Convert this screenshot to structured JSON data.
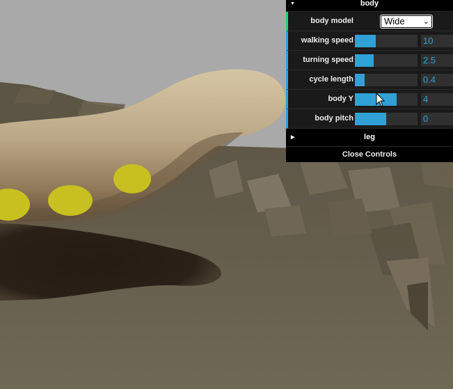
{
  "gui": {
    "body_folder": {
      "title": "body",
      "body_model": {
        "label": "body model",
        "value": "Wide"
      },
      "sliders": [
        {
          "label": "walking speed",
          "value": "10",
          "fill_fraction": 0.33
        },
        {
          "label": "turning speed",
          "value": "2.5",
          "fill_fraction": 0.3
        },
        {
          "label": "cycle length",
          "value": "0.4",
          "fill_fraction": 0.15
        },
        {
          "label": "body Y",
          "value": "4",
          "fill_fraction": 0.67
        },
        {
          "label": "body pitch",
          "value": "0",
          "fill_fraction": 0.5
        }
      ]
    },
    "leg_folder": {
      "title": "leg"
    },
    "close_label": "Close Controls"
  },
  "colors": {
    "sky": "#a9a9a9",
    "terrain": "#6e6553",
    "body_light": "#c9b794",
    "body_dark": "#7e6a4f",
    "foot": "#c8c020",
    "shadow": "#2a1f17",
    "accent": "#2fa1d6",
    "select_accent": "#1ed36f"
  }
}
